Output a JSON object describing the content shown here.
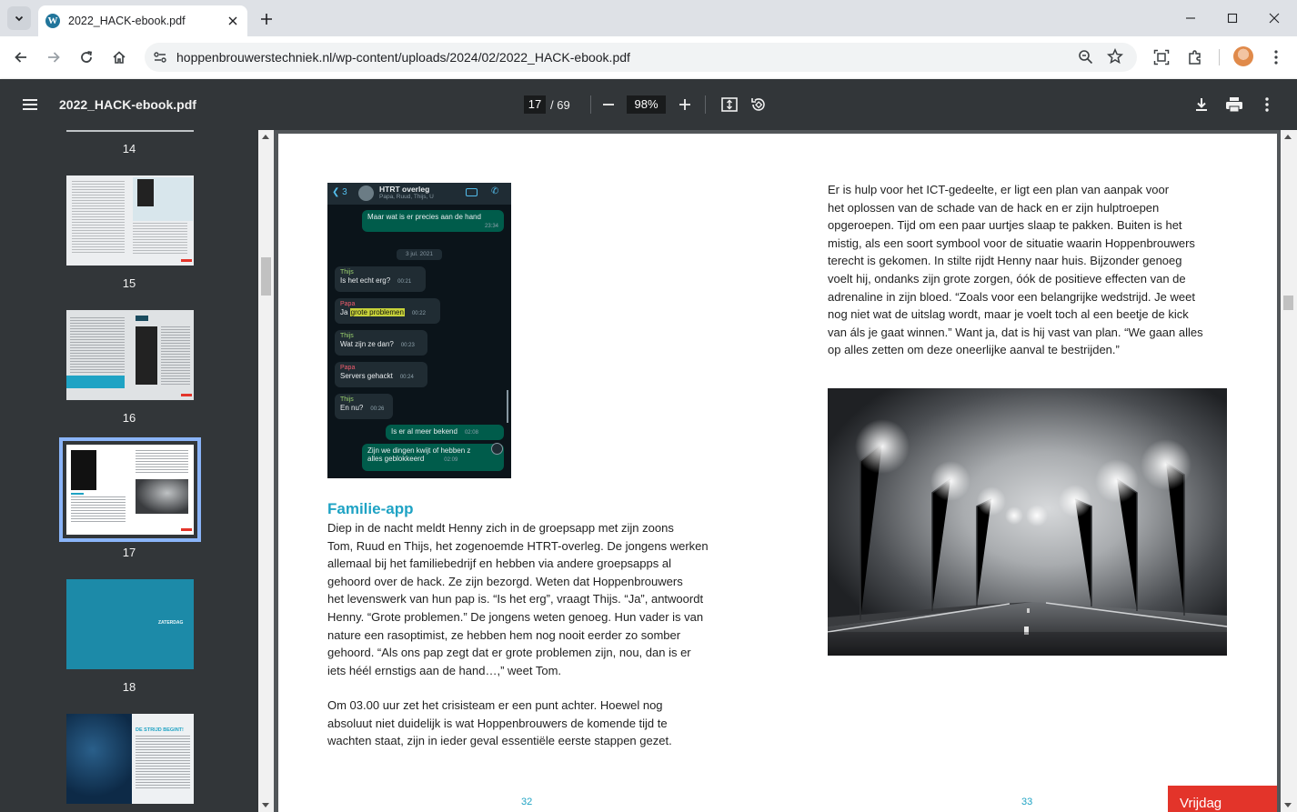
{
  "browser": {
    "tab_title": "2022_HACK-ebook.pdf",
    "url": "hoppenbrouwerstechniek.nl/wp-content/uploads/2024/02/2022_HACK-ebook.pdf",
    "favicon_letter": "W"
  },
  "pdf_toolbar": {
    "file_name": "2022_HACK-ebook.pdf",
    "current_page": "17",
    "total_pages": "/ 69",
    "zoom": "98%"
  },
  "thumbnails": [
    {
      "label": "14"
    },
    {
      "label": "15"
    },
    {
      "label": "16"
    },
    {
      "label": "17"
    },
    {
      "label": "18"
    }
  ],
  "thumb18_text": "ZATERDAG",
  "thumb19_text": "DE STRIJD BEGINT!",
  "chat": {
    "title": "HTRT overleg",
    "members": "Papa, Ruud, Thijs, U",
    "back_count": "3",
    "date": "3 jul. 2021",
    "messages": [
      {
        "dir": "out",
        "sender": "",
        "text": "Maar wat is er precies aan de hand",
        "time": "23:34"
      },
      {
        "dir": "in",
        "sender": "Thijs",
        "text": "Is het echt erg?",
        "time": "00:21"
      },
      {
        "dir": "in",
        "sender": "Papa",
        "text_pre": "Ja ",
        "text_highlight": "grote problemen",
        "time": "00:22"
      },
      {
        "dir": "in",
        "sender": "Thijs",
        "text": "Wat zijn ze dan?",
        "time": "00:23"
      },
      {
        "dir": "in",
        "sender": "Papa",
        "text": "Servers gehackt",
        "time": "00:24"
      },
      {
        "dir": "in",
        "sender": "Thijs",
        "text": "En nu?",
        "time": "00:26"
      },
      {
        "dir": "out",
        "sender": "",
        "text": "Is er al meer bekend",
        "time": "02:08"
      },
      {
        "dir": "out",
        "sender": "",
        "text_line1": "Zijn we dingen kwijt of hebben z",
        "text_line2": "alles geblokkeerd",
        "time": "02:09"
      }
    ],
    "colors": {
      "thijs": "#9bd16f",
      "papa": "#f15c6d"
    }
  },
  "page_left": {
    "heading": "Familie-app",
    "paragraph1": [
      "Diep in de nacht meldt Henny zich in de groepsapp met zijn zoons",
      "Tom, Ruud en Thijs, het zogenoemde HTRT-overleg. De jongens werken",
      "allemaal bij het familiebedrijf en hebben via andere groepsapps al",
      "gehoord over de hack. Ze zijn bezorgd. Weten dat Hoppenbrouwers",
      "het levenswerk van hun pap is. “Is het erg”, vraagt Thijs. “Ja”, antwoordt",
      "Henny. “Grote problemen.” De jongens weten genoeg. Hun vader is van",
      "nature een rasoptimist, ze hebben hem nog nooit eerder zo somber",
      "gehoord. “Als ons pap zegt dat er grote problemen zijn, nou, dan is er",
      "iets héél ernstigs aan de hand…,” weet Tom."
    ],
    "paragraph2": [
      "Om 03.00 uur zet het crisisteam er een punt achter. Hoewel nog",
      "absoluut niet duidelijk is wat Hoppenbrouwers de komende tijd te",
      "wachten staat, zijn in ieder geval essentiële eerste stappen gezet."
    ],
    "page_number": "32"
  },
  "page_right": {
    "paragraph": [
      "Er is hulp voor het ICT-gedeelte, er ligt een plan van aanpak voor",
      "het oplossen van de schade van de hack en er zijn hulptroepen",
      "opgeroepen. Tijd om een paar uurtjes slaap te pakken. Buiten is het",
      "mistig, als een soort symbool voor de situatie waarin Hoppenbrouwers",
      "terecht is gekomen. In stilte rijdt Henny naar huis. Bijzonder genoeg",
      "voelt hij, ondanks zijn grote zorgen, óók de positieve effecten van de",
      "adrenaline in zijn bloed. “Zoals voor een belangrijke wedstrijd. Je weet",
      "nog niet wat de uitslag wordt, maar je voelt toch al een beetje de kick",
      "van áls je gaat winnen.” Want ja, dat is hij vast van plan. “We gaan alles",
      "op alles zetten om deze oneerlijke aanval te bestrijden.”"
    ],
    "page_number": "33",
    "section_tab": "Vrijdag"
  },
  "colors": {
    "accent_blue": "#1fa3c4",
    "section_red": "#e3342a",
    "pdf_toolbar": "#323639",
    "selected_thumb": "#8ab4f8"
  }
}
